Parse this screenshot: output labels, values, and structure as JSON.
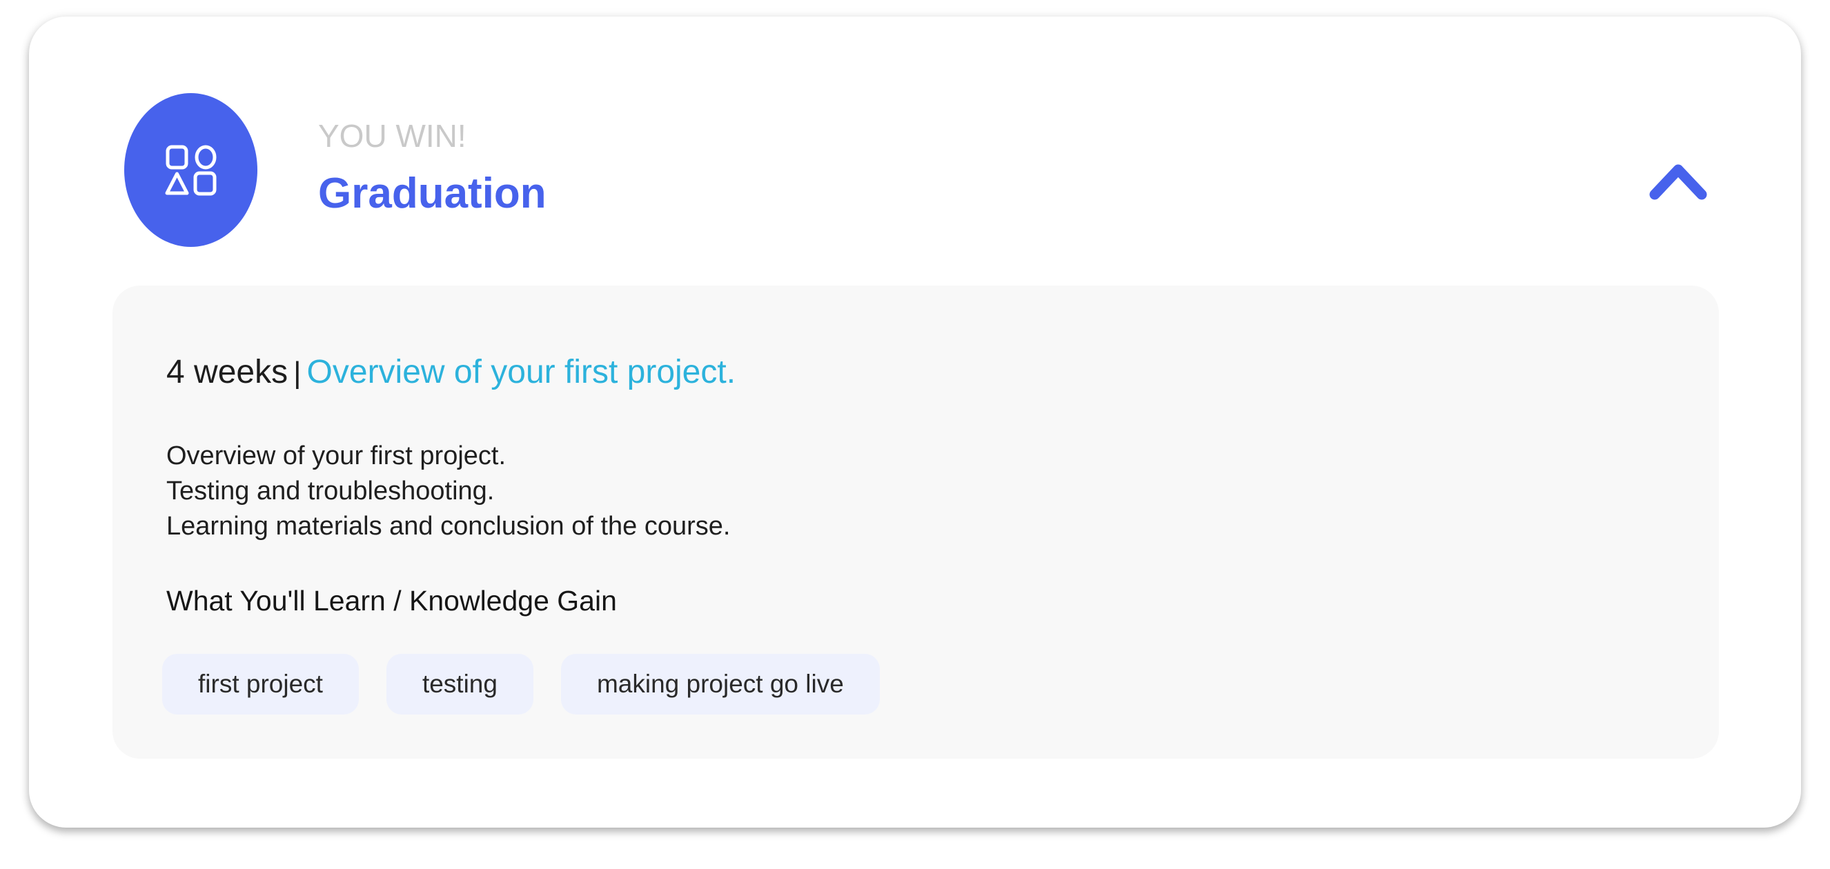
{
  "colors": {
    "accent": "#4762ec",
    "overview": "#2cb2dc",
    "kicker": "#c9c9c9",
    "tag_bg": "#eef1fd",
    "panel_bg": "#f8f8f8"
  },
  "header": {
    "icon": "shapes-icon",
    "kicker": "YOU WIN!",
    "title": "Graduation",
    "toggle_icon": "chevron-up-icon"
  },
  "panel": {
    "duration": "4 weeks",
    "separator": "|",
    "overview_link": "Overview of your first project.",
    "description": [
      "Overview of your first project.",
      "Testing and troubleshooting.",
      "Learning materials and conclusion of the course."
    ],
    "learn_heading": "What You'll Learn / Knowledge Gain",
    "tags": [
      "first project",
      "testing",
      "making project go live"
    ]
  }
}
